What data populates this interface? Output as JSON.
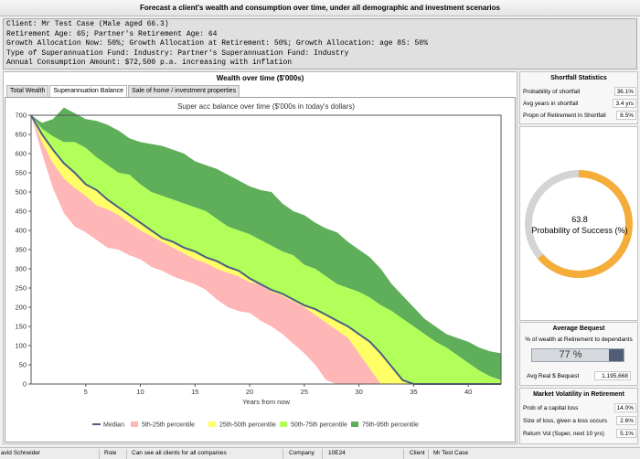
{
  "header": {
    "title": "Forecast a client's wealth and consumption over time, under all demographic and investment scenarios"
  },
  "info": {
    "line1": "Client: Mr Test Case (Male aged 66.3)",
    "line2": "Retirement Age: 65; Partner's Retirement Age: 64",
    "line3": "Growth Allocation Now: 50%; Growth Allocation at Retirement: 50%; Growth Allocation: age 85: 50%",
    "line4": "Type of Superannuation Fund: Industry: Partner's Superannuation Fund: Industry",
    "line5": "Annual Consumption Amount: $72,500 p.a. increasing with inflation"
  },
  "wealth_panel": {
    "title": "Wealth over time ($'000s)",
    "tabs": [
      "Total Wealth",
      "Superannuation Balance",
      "Sale of home / investment properties"
    ],
    "active_tab": 1
  },
  "chart_data": {
    "type": "area",
    "title": "Super acc balance  over time ($'000s in today's dollars)",
    "xlabel": "Years from now",
    "ylabel": "",
    "xlim": [
      0,
      43
    ],
    "ylim": [
      0,
      700
    ],
    "xticks": [
      5,
      10,
      15,
      20,
      25,
      30,
      35,
      40
    ],
    "yticks": [
      0,
      50,
      100,
      150,
      200,
      250,
      300,
      350,
      400,
      450,
      500,
      550,
      600,
      650,
      700
    ],
    "grid": false,
    "legend_position": "bottom",
    "x": [
      0,
      1,
      2,
      3,
      4,
      5,
      6,
      7,
      8,
      9,
      10,
      11,
      12,
      13,
      14,
      15,
      16,
      17,
      18,
      19,
      20,
      21,
      22,
      23,
      24,
      25,
      26,
      27,
      28,
      29,
      30,
      31,
      32,
      33,
      34,
      35,
      36,
      37,
      38,
      39,
      40,
      41,
      42,
      43
    ],
    "percentiles": {
      "p5": [
        700,
        600,
        510,
        445,
        410,
        395,
        375,
        355,
        350,
        335,
        325,
        305,
        295,
        280,
        270,
        260,
        245,
        220,
        200,
        190,
        185,
        165,
        150,
        130,
        105,
        80,
        50,
        10,
        0,
        0,
        0,
        0,
        0,
        0,
        0,
        0,
        0,
        0,
        0,
        0,
        0,
        0,
        0,
        0
      ],
      "p25": [
        700,
        630,
        575,
        535,
        510,
        490,
        465,
        455,
        440,
        420,
        400,
        385,
        370,
        355,
        340,
        325,
        315,
        300,
        290,
        280,
        265,
        260,
        240,
        230,
        215,
        200,
        180,
        160,
        140,
        120,
        80,
        40,
        0,
        0,
        0,
        0,
        0,
        0,
        0,
        0,
        0,
        0,
        0,
        0
      ],
      "median": [
        700,
        650,
        610,
        575,
        550,
        520,
        505,
        480,
        460,
        440,
        420,
        400,
        380,
        370,
        355,
        345,
        330,
        320,
        305,
        295,
        275,
        260,
        245,
        235,
        220,
        205,
        195,
        180,
        165,
        150,
        130,
        110,
        80,
        45,
        10,
        0,
        0,
        0,
        0,
        0,
        0,
        0,
        0,
        0
      ],
      "p50": [
        700,
        650,
        610,
        575,
        550,
        520,
        505,
        480,
        460,
        440,
        420,
        400,
        380,
        370,
        355,
        345,
        330,
        320,
        305,
        295,
        275,
        260,
        245,
        235,
        220,
        205,
        195,
        180,
        165,
        150,
        130,
        110,
        80,
        45,
        10,
        0,
        0,
        0,
        0,
        0,
        0,
        0,
        0,
        0
      ],
      "p75": [
        700,
        665,
        645,
        630,
        630,
        615,
        590,
        570,
        550,
        545,
        520,
        500,
        490,
        480,
        470,
        460,
        450,
        430,
        410,
        400,
        390,
        375,
        360,
        345,
        335,
        310,
        300,
        280,
        260,
        250,
        240,
        225,
        205,
        190,
        170,
        150,
        130,
        110,
        95,
        75,
        55,
        35,
        20,
        10
      ],
      "p95": [
        700,
        680,
        690,
        720,
        705,
        690,
        685,
        675,
        660,
        640,
        630,
        625,
        620,
        610,
        600,
        580,
        570,
        560,
        545,
        530,
        515,
        505,
        500,
        470,
        450,
        440,
        420,
        405,
        395,
        370,
        350,
        330,
        300,
        260,
        230,
        200,
        170,
        150,
        130,
        120,
        110,
        95,
        85,
        80
      ]
    },
    "legend": [
      "Median",
      "5th-25th percentile",
      "25th-50th percentile",
      "50th-75th percentile",
      "75th-95th percentile"
    ],
    "colors": {
      "median": "#4a5f85",
      "band_5_25": "#ffb6b6",
      "band_25_50": "#ffff66",
      "band_50_75": "#b2ff59",
      "band_75_95": "#5fae5a"
    }
  },
  "shortfall": {
    "title": "Shortfall Statistics",
    "rows": [
      {
        "label": "Probability of shortfall",
        "value": "36.1%"
      },
      {
        "label": "Avg years in shortfall",
        "value": "3.4 yrs"
      },
      {
        "label": "Propn of Retirement in Shortfall",
        "value": "8.5%"
      }
    ]
  },
  "gauge": {
    "value_text": "63.8",
    "label": "Probability of Success (%)",
    "value": 63.8,
    "color": "#f5ad3a",
    "track": "#d4d4d4"
  },
  "bequest": {
    "title": "Average Bequest",
    "subtitle": "% of wealth at Retirement to dependants",
    "percent_text": "77 %",
    "fraction": 0.77,
    "real_label": "Avg Real $ Bequest",
    "real_value": "1,195,668"
  },
  "volatility": {
    "title": "Market Volatility in Retirement",
    "rows": [
      {
        "label": "Prob of a capital loss",
        "value": "14.0%"
      },
      {
        "label": "Size of loss, given a loss occurs",
        "value": "2.6%"
      },
      {
        "label": "Return Vol (Super, next 10 yrs)",
        "value": "5.1%"
      }
    ]
  },
  "status": {
    "user": "avid Schneider",
    "role_label": "Role",
    "role_value": "Can see all clients for all companies",
    "company_label": "Company",
    "company_value": "10E24",
    "client_label": "Client",
    "client_value": "Mr Test Case"
  }
}
